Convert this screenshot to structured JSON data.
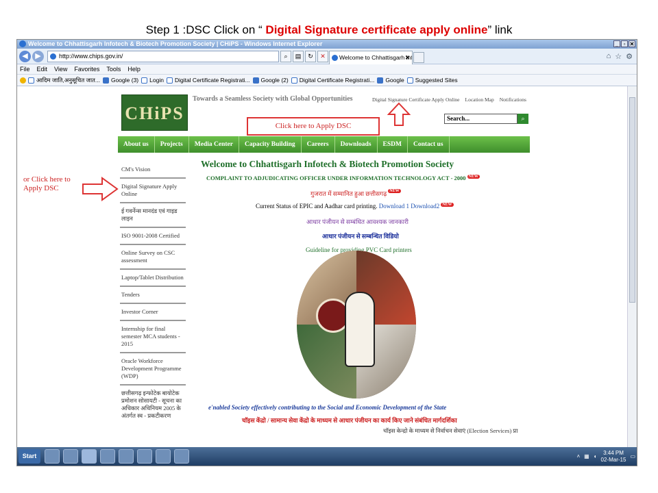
{
  "slide": {
    "title_prefix": "Step 1 :DSC Click on “ ",
    "title_link": "Digital Signature certificate apply online",
    "title_suffix": "” link"
  },
  "browser": {
    "window_title": "Welcome to Chhattisgarh Infotech & Biotech Promotion Society | CHiPS - Windows Internet Explorer",
    "address": "http://www.chips.gov.in/",
    "tab_label": "Welcome to Chhattisgarh Inf...",
    "tab_close": "✕",
    "menu": [
      "File",
      "Edit",
      "View",
      "Favorites",
      "Tools",
      "Help"
    ],
    "favorites": [
      "आदिम जाति,अनुसूचित जात...",
      "Google (3)",
      "Login",
      "Digital Certificate Registrati...",
      "Google (2)",
      "Digital Certificate Registrati...",
      "Google",
      "Suggested Sites"
    ]
  },
  "site": {
    "logo_text": "CHiPS",
    "tagline": "Towards a Seamless Society with Global Opportunities",
    "top_links": [
      "Digital Signature Certificate Apply Online",
      "Location Map",
      "Notifications"
    ],
    "search_placeholder": "Search...",
    "nav": [
      "About us",
      "Projects",
      "Media Center",
      "Capacity Building",
      "Careers",
      "Downloads",
      "ESDM",
      "Contact us"
    ],
    "sidebar": [
      "CM's Vision",
      "Digital Signature Apply Online",
      "ई गवर्नेन्स मानदंड एवं गाइड लाइन",
      "ISO 9001-2008 Certified",
      "Online Survey on CSC assessment",
      "Laptop/Tablet Distribution",
      "Tenders",
      "Investor Corner",
      "Internship for final semester MCA students - 2015",
      "Oracle Workforce Development Programme (WDP)",
      "छत्तीसगढ़ इन्फोटेक बायोटेक प्रमोशन सोसायटी - सूचना का अधिकार अधिनियम 2005 के अंतर्गत स्व - प्रकटीकरण"
    ],
    "welcome": "Welcome to Chhattisgarh Infotech & Biotech Promotion Society",
    "complaint": "COMPLAINT TO ADJUDICATING OFFICER UNDER INFORMATION TECHNOLOGY ACT - 2000",
    "gujarat": "गुजरात में सम्मानित हुआ छत्तीसगढ़",
    "epic_text": "Current Status of EPIC and Aadhar card printing.",
    "download1": "Download 1",
    "download2": "Download2",
    "aadhar_info": "आधार पंजीयन से सम्बंधित आवश्यक जानकारी",
    "aadhar_video": "आधार पंजीयन से सम्बन्धित विडियो",
    "pvc": "Guideline for providing PVC Card printers",
    "enabled_society": "e'nabled Society effectively contributing to the Social and Economic Development of the State",
    "choice_centre": "चॉइस केंद्रो / सामान्य सेवा केंद्रो के माध्यम से आधार पंजीयन का कार्य किए जाने संबंधित मार्गदर्शिका",
    "election": "चॉइस केन्द्रो के माध्यम से निर्वाचन सेवाएं (Election Services) प्रा",
    "new_badge": "NEW"
  },
  "annotations": {
    "box": "Click here to Apply DSC",
    "left": "or Click here to Apply DSC"
  },
  "taskbar": {
    "start": "Start",
    "time": "3:44 PM",
    "date": "02-Mar-15"
  },
  "colors": {
    "annotation": "#d33",
    "nav_green": "#4e9f36",
    "heading_green": "#1f6f2a"
  }
}
